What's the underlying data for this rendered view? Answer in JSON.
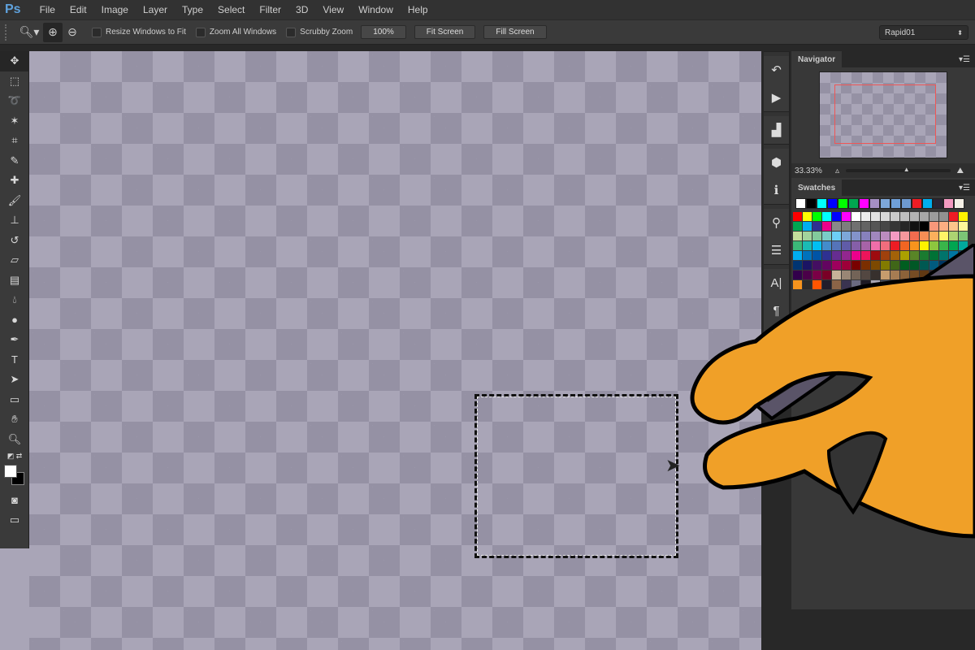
{
  "app": {
    "logo": "Ps"
  },
  "menu": [
    "File",
    "Edit",
    "Image",
    "Layer",
    "Type",
    "Select",
    "Filter",
    "3D",
    "View",
    "Window",
    "Help"
  ],
  "options": {
    "resize_windows": "Resize Windows to Fit",
    "zoom_all": "Zoom All Windows",
    "scrubby": "Scrubby Zoom",
    "btn_100": "100%",
    "fit_screen": "Fit Screen",
    "fill_screen": "Fill Screen",
    "preset": "Rapid01"
  },
  "navigator": {
    "title": "Navigator",
    "zoom": "33.33%"
  },
  "swatches": {
    "title": "Swatches",
    "recent": [
      "#ffffff",
      "#000000",
      "#00ffff",
      "#0000ff",
      "#00ff00",
      "#00a650",
      "#ff00ff",
      "#a58fc4",
      "#7da7d9",
      "#6f9fd8",
      "#6e9ad0",
      "#ed1c24",
      "#00aeef",
      "#2b2433",
      "#f49ac1",
      "#f5f0e6"
    ],
    "grid": [
      [
        "#ff0000",
        "#ffff00",
        "#00ff00",
        "#00ffff",
        "#0000ff",
        "#ff00ff",
        "#ffffff",
        "#ebebeb",
        "#e1e1e1",
        "#d7d7d7",
        "#cbcbcb",
        "#c0c0c0",
        "#b4b4b4",
        "#a8a8a8",
        "#9c9c9c",
        "#919191",
        "#ed1c24",
        "#fff200"
      ],
      [
        "#00a651",
        "#00aeef",
        "#2e3192",
        "#ec008c",
        "#898989",
        "#7d7d7d",
        "#707070",
        "#636363",
        "#555555",
        "#464646",
        "#363636",
        "#262626",
        "#111111",
        "#000000",
        "#f7977a",
        "#fbad82",
        "#fdc68a",
        "#fff799"
      ],
      [
        "#c4df9b",
        "#a3d39c",
        "#82ca9c",
        "#7accc8",
        "#6dcff6",
        "#7da7d9",
        "#8393ca",
        "#8781bd",
        "#a187be",
        "#bc8cbf",
        "#f49ac2",
        "#f6989d",
        "#f26c4f",
        "#f68e55",
        "#fbaf5c",
        "#fff467",
        "#acd372",
        "#7cc576"
      ],
      [
        "#3bb878",
        "#1abbb4",
        "#00bff3",
        "#438ccb",
        "#5574b9",
        "#605ca8",
        "#855fa8",
        "#a763a8",
        "#f06ea9",
        "#f26d7d",
        "#ed1c24",
        "#f26522",
        "#f7941d",
        "#fff200",
        "#8dc63f",
        "#39b54a",
        "#00a651",
        "#00a99d"
      ],
      [
        "#00aeef",
        "#0072bc",
        "#0054a6",
        "#2e3192",
        "#662d91",
        "#92278f",
        "#ec008c",
        "#ed145b",
        "#9e0b0f",
        "#a0410d",
        "#a36209",
        "#aba000",
        "#598527",
        "#1a7b30",
        "#007236",
        "#00746b",
        "#0076a3",
        "#004b80"
      ],
      [
        "#003471",
        "#1b1464",
        "#440e62",
        "#630460",
        "#9e005d",
        "#9e0039",
        "#790000",
        "#7b2e00",
        "#7d4900",
        "#827b00",
        "#406618",
        "#005e20",
        "#005826",
        "#005952",
        "#005b7f",
        "#003663",
        "#002157",
        "#0d004c"
      ],
      [
        "#32004b",
        "#4b0049",
        "#7b0046",
        "#7a0026",
        "#c7b299",
        "#998675",
        "#736357",
        "#534741",
        "#37302d",
        "#c69c6d",
        "#a67c52",
        "#8c6239",
        "#754c24",
        "#603913",
        "#2b2433",
        "#f7941d",
        "#f5f0e6"
      ],
      [
        "#f7941d",
        "#2b2b2b",
        "#ff5500",
        "#201c2b",
        "#8b6447",
        "#3a3350",
        "#6a6a80",
        "#1d1a24",
        "#a8a6b4",
        "#474f5e"
      ]
    ]
  },
  "colors": {
    "accent": "#5fa2dd",
    "hand": "#f0a028",
    "nav_rect": "#f05555"
  }
}
